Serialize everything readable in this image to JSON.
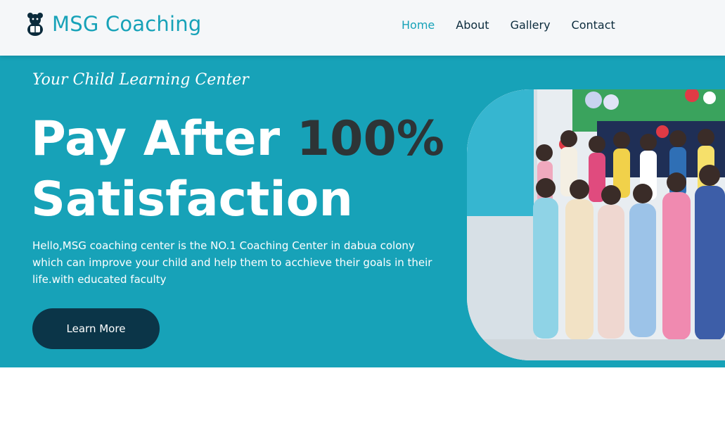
{
  "brand": {
    "name": "MSG Coaching",
    "icon": "bear-logo-icon"
  },
  "nav": {
    "items": [
      {
        "label": "Home",
        "active": true
      },
      {
        "label": "About",
        "active": false
      },
      {
        "label": "Gallery",
        "active": false
      },
      {
        "label": "Contact",
        "active": false
      }
    ]
  },
  "hero": {
    "tagline": "Your Child Learning Center",
    "headline_part1": "Pay After ",
    "headline_highlight": "100%",
    "headline_part2": "Satisfaction",
    "description": "Hello,MSG coaching center is the NO.1 Coaching Center in dabua colony which can improve your child and help them to acchieve their goals in their life.with educated faculty",
    "cta_label": "Learn More",
    "image": "group-photo-students-and-teacher"
  },
  "colors": {
    "accent": "#17a2b8",
    "dark": "#0b3548",
    "nav_text": "#0b2b3c",
    "highlight_text": "#2d3436"
  }
}
